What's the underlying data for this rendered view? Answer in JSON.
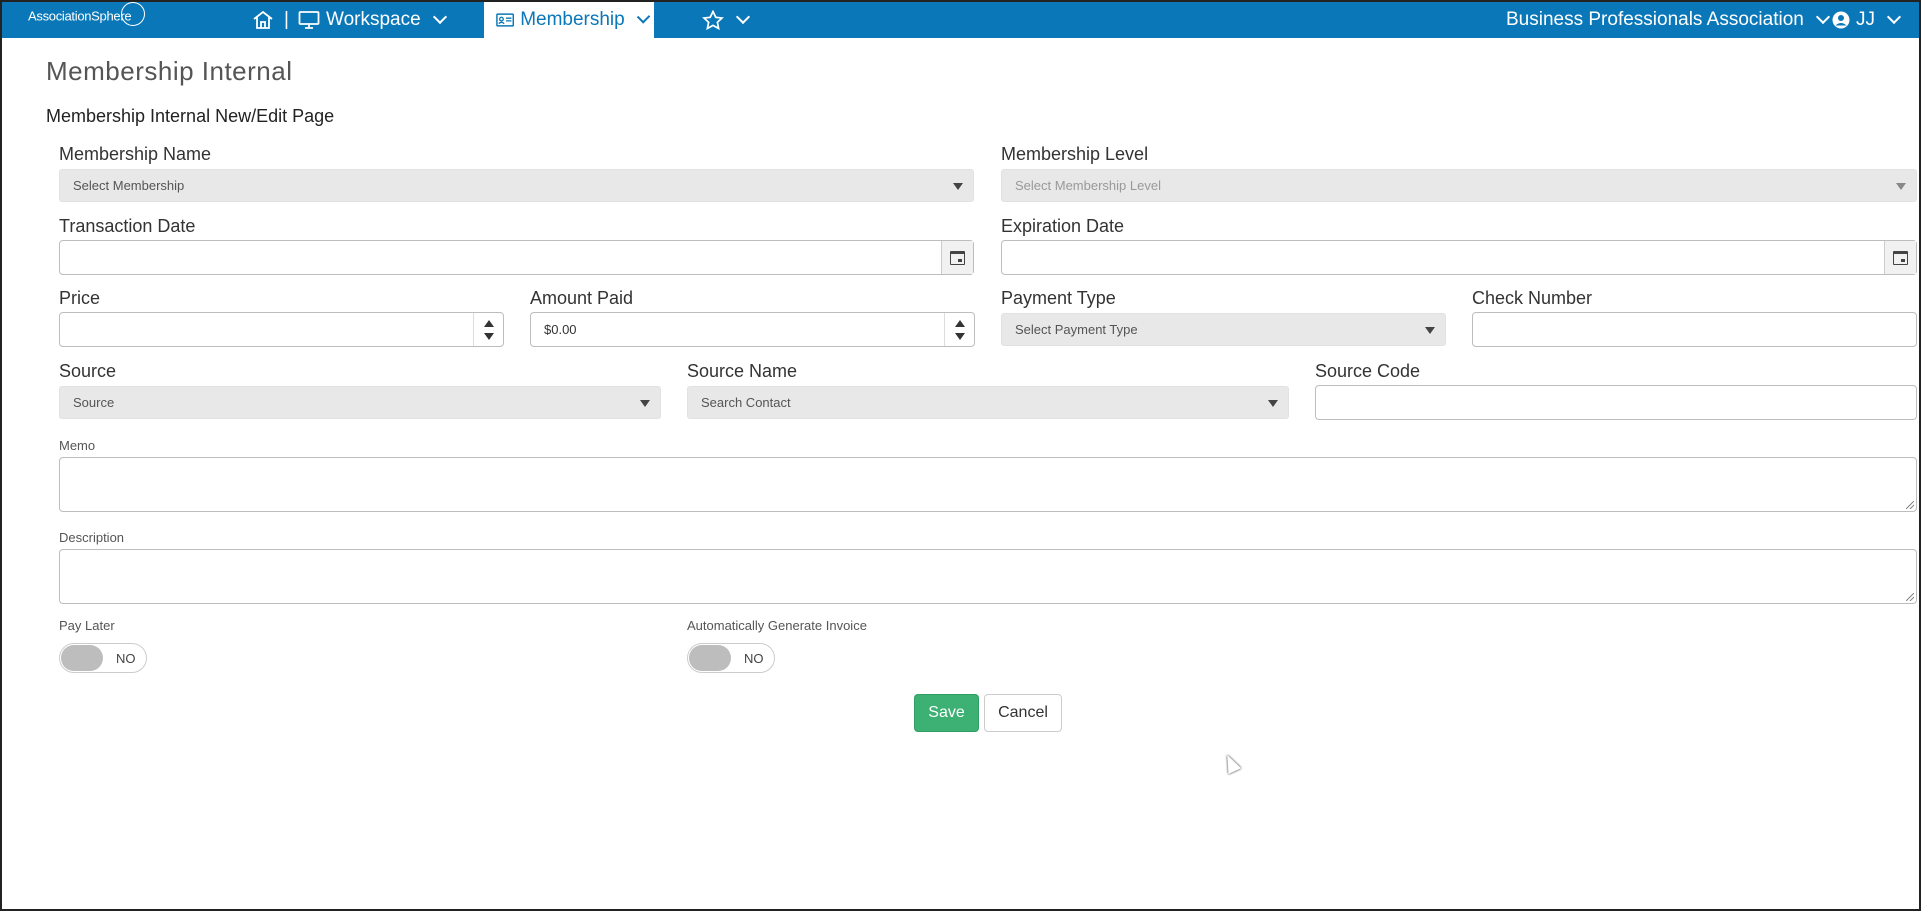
{
  "topnav": {
    "logo": "AssociationSphere",
    "separator": "|",
    "workspace": "Workspace",
    "membership": "Membership",
    "org": "Business Professionals Association",
    "user": "JJ"
  },
  "page": {
    "title": "Membership Internal",
    "subtitle": "Membership Internal New/Edit Page"
  },
  "form": {
    "membership_name": {
      "label": "Membership Name",
      "placeholder": "Select Membership"
    },
    "membership_level": {
      "label": "Membership Level",
      "placeholder": "Select Membership Level"
    },
    "transaction_date": {
      "label": "Transaction Date",
      "value": ""
    },
    "expiration_date": {
      "label": "Expiration Date",
      "value": ""
    },
    "price": {
      "label": "Price",
      "value": ""
    },
    "amount_paid": {
      "label": "Amount Paid",
      "value": "$0.00"
    },
    "payment_type": {
      "label": "Payment Type",
      "placeholder": "Select Payment Type"
    },
    "check_number": {
      "label": "Check Number",
      "value": ""
    },
    "source": {
      "label": "Source",
      "placeholder": "Source"
    },
    "source_name": {
      "label": "Source Name",
      "placeholder": "Search Contact"
    },
    "source_code": {
      "label": "Source Code",
      "value": ""
    },
    "memo": {
      "label": "Memo"
    },
    "description": {
      "label": "Description"
    },
    "pay_later": {
      "label": "Pay Later",
      "state": "NO"
    },
    "auto_invoice": {
      "label": "Automatically Generate Invoice",
      "state": "NO"
    }
  },
  "actions": {
    "save": "Save",
    "cancel": "Cancel"
  },
  "colors": {
    "nav": "#0a77b8",
    "save": "#3db073"
  }
}
